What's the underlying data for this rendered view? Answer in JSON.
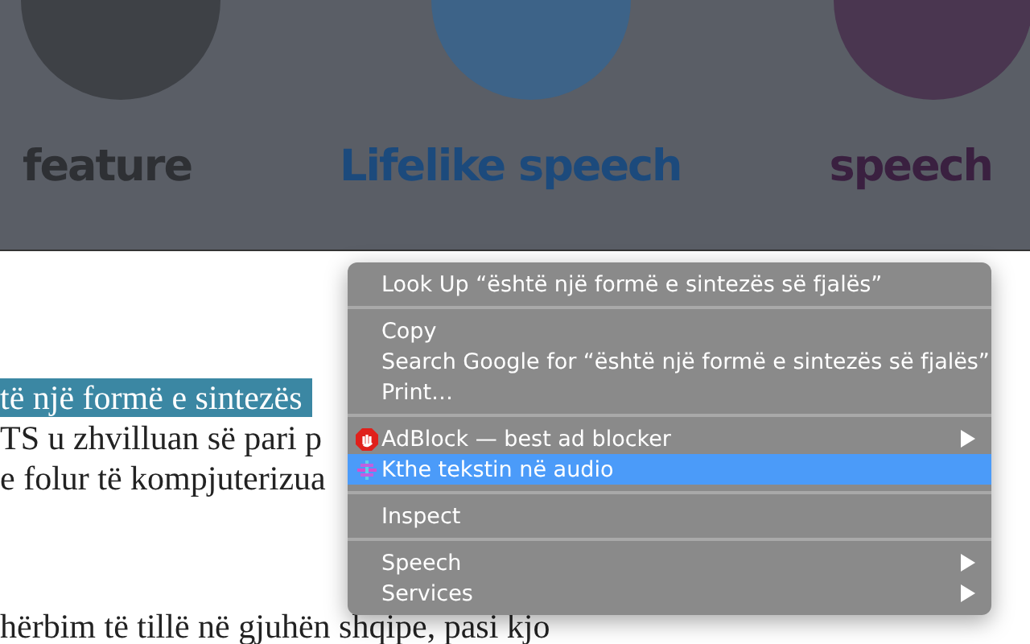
{
  "banner": {
    "labels": [
      {
        "text": "feature",
        "color": "#2e3034"
      },
      {
        "text": "Lifelike speech",
        "color": "#1c4a7c"
      },
      {
        "text": "speech",
        "color": "#3a2040"
      }
    ]
  },
  "article": {
    "lines": [
      {
        "text": "të një formë e sintezës",
        "selected": true
      },
      {
        "text": "TS u zhvilluan së pari p",
        "selected": false
      },
      {
        "text": "e folur të kompjuterizua",
        "selected": false
      }
    ],
    "last_line": "hërbim të tillë në gjuhën shqipe, pasi kjo"
  },
  "context_menu": {
    "items": [
      {
        "kind": "item",
        "label": "Look Up “është një formë e sintezës së fjalës”",
        "selected": false,
        "submenu": false
      },
      {
        "kind": "separator"
      },
      {
        "kind": "item",
        "label": "Copy",
        "selected": false,
        "submenu": false
      },
      {
        "kind": "item",
        "label": "Search Google for “është një formë e sintezës së fjalës”",
        "selected": false,
        "submenu": false
      },
      {
        "kind": "item",
        "label": "Print…",
        "selected": false,
        "submenu": false
      },
      {
        "kind": "separator"
      },
      {
        "kind": "adblock",
        "label": "AdBlock — best ad blocker",
        "selected": false,
        "submenu": true
      },
      {
        "kind": "audio",
        "label": "Kthe tekstin në audio",
        "selected": true,
        "submenu": false
      },
      {
        "kind": "separator"
      },
      {
        "kind": "item",
        "label": "Inspect",
        "selected": false,
        "submenu": false
      },
      {
        "kind": "separator"
      },
      {
        "kind": "item",
        "label": "Speech",
        "selected": false,
        "submenu": true
      },
      {
        "kind": "item",
        "label": "Services",
        "selected": false,
        "submenu": true
      }
    ]
  }
}
